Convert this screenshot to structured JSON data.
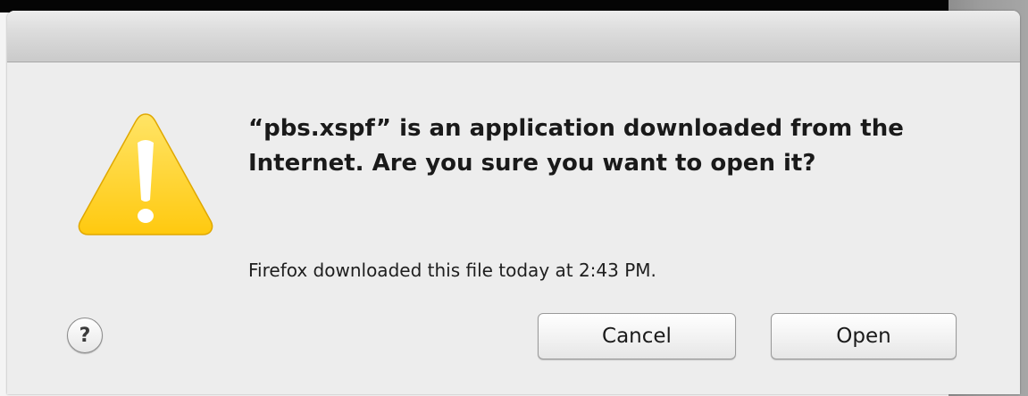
{
  "dialog": {
    "message": "“pbs.xspf” is an application downloaded from the Internet. Are you sure you want to open it?",
    "info": "Firefox downloaded this file today at 2:43 PM.",
    "icon": "warning-triangle-icon",
    "help_label": "?",
    "buttons": {
      "cancel_label": "Cancel",
      "open_label": "Open"
    }
  },
  "colors": {
    "warning_yellow": "#ffd21e",
    "dialog_background": "#ededed"
  }
}
